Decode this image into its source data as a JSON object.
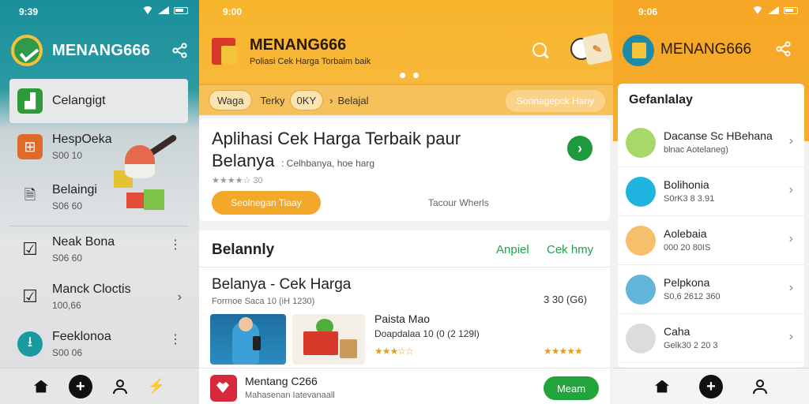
{
  "left": {
    "time": "9:39",
    "app_title": "MENANG666",
    "items": [
      {
        "label": "Celangigt",
        "sub": ""
      },
      {
        "label": "HespOeka",
        "sub": "S00 10"
      },
      {
        "label": "Belaingi",
        "sub": "S06 60"
      },
      {
        "label": "Neak Bona",
        "sub": "S06 60"
      },
      {
        "label": "Manck Cloctis",
        "sub": "100,66"
      },
      {
        "label": "Feeklonoa",
        "sub": "S00 06"
      }
    ]
  },
  "middle": {
    "time": "9:00",
    "app_title": "MENANG666",
    "subtitle": "Poliasi Cek Harga Torbaim baik",
    "chips": [
      "Waga",
      "Terky",
      "0KY",
      "Belajal"
    ],
    "chip_cta": "Sonnagepck Hany",
    "hero": {
      "title": "Aplihasi Cek Harga Terbaik paur Belanya",
      "caption": ": Celhbanya, hoe harg",
      "stars": "★★★★☆ 30",
      "primary": "Seolnegan Tiaay",
      "secondary": "Tacour Wherls"
    },
    "section": {
      "title": "Belannly",
      "tab1": "Anpiel",
      "tab2": "Cek hmy",
      "heading": "Belanya - Cek Harga",
      "meta": "Forrnoe Saca 10 (iH 1230)",
      "price": "3 30 (G6)",
      "product_title": "Paista Mao",
      "product_meta": "Doapdalaa 10 (0 (2 129l)",
      "stars_a": "★★★☆☆",
      "stars_b": "★★★★★"
    },
    "install": {
      "name": "Mentang C266",
      "desc": "Mahasenan Iatevanaall",
      "button": "Meam"
    }
  },
  "right": {
    "time": "9:06",
    "app_title": "MENANG666",
    "heading": "Gefanlalay",
    "items": [
      {
        "label": "Dacanse Sc HBehana",
        "sub": "blnac Aotelaneg)",
        "color": "#a8d86a"
      },
      {
        "label": "Bolihonia",
        "sub": "S0rK3 8 3.91",
        "color": "#1fb4e0"
      },
      {
        "label": "Aolebaia",
        "sub": "000 20 80IS",
        "color": "#f6c06a"
      },
      {
        "label": "Pelpkona",
        "sub": "S0,6 2612 360",
        "color": "#62b4d8"
      },
      {
        "label": "Caha",
        "sub": "Gelk30 2 20 3",
        "color": "#dcdcdc"
      }
    ]
  },
  "colors": {
    "teal": "#1a8f9a",
    "orange": "#f7b52c",
    "green": "#22a43c"
  }
}
